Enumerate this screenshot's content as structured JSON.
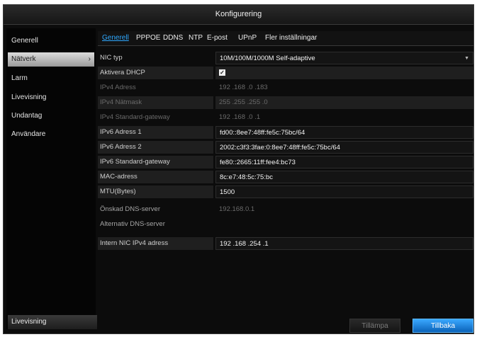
{
  "window": {
    "title": "Konfigurering"
  },
  "sidebar": {
    "items": [
      {
        "label": "Generell"
      },
      {
        "label": "Nätverk",
        "chevron": "›"
      },
      {
        "label": "Larm"
      },
      {
        "label": "Livevisning"
      },
      {
        "label": "Undantag"
      },
      {
        "label": "Användare"
      }
    ],
    "bottom_label": "Livevisning"
  },
  "tabs": [
    "Generell",
    "PPPOE",
    "DDNS",
    "NTP",
    "E-post",
    "UPnP",
    "Fler inställningar"
  ],
  "form": {
    "nic_type": {
      "label": "NIC typ",
      "value": "10M/100M/1000M Self-adaptive",
      "arrow_icon": "chevron-down-icon"
    },
    "dhcp": {
      "label": "Aktivera DHCP",
      "checked": true,
      "check_glyph": "✓"
    },
    "ipv4_address": {
      "label": "IPv4 Adress",
      "value": "192 .168 .0     .183"
    },
    "ipv4_mask": {
      "label": "IPv4 Nätmask",
      "value": "255 .255 .255 .0"
    },
    "ipv4_gateway": {
      "label": "IPv4 Standard-gateway",
      "value": "192 .168 .0     .1"
    },
    "ipv6_address1": {
      "label": "IPv6 Adress 1",
      "value": "fd00::8ee7:48ff:fe5c:75bc/64"
    },
    "ipv6_address2": {
      "label": "IPv6 Adress 2",
      "value": "2002:c3f3:3fae:0:8ee7:48ff:fe5c:75bc/64"
    },
    "ipv6_gateway": {
      "label": "IPv6 Standard-gateway",
      "value": "fe80::2665:11ff:fee4:bc73"
    },
    "mac": {
      "label": "MAC-adress",
      "value": "8c:e7:48:5c:75:bc"
    },
    "mtu": {
      "label": "MTU(Bytes)",
      "value": "1500"
    },
    "dns_preferred": {
      "label": "Önskad DNS-server",
      "value": "192.168.0.1"
    },
    "dns_alternate": {
      "label": "Alternativ DNS-server",
      "value": ""
    },
    "internal_nic": {
      "label": "Intern NIC IPv4 adress",
      "value": "192 .168 .254 .1"
    }
  },
  "buttons": {
    "apply": "Tillämpa",
    "back": "Tillbaka"
  }
}
